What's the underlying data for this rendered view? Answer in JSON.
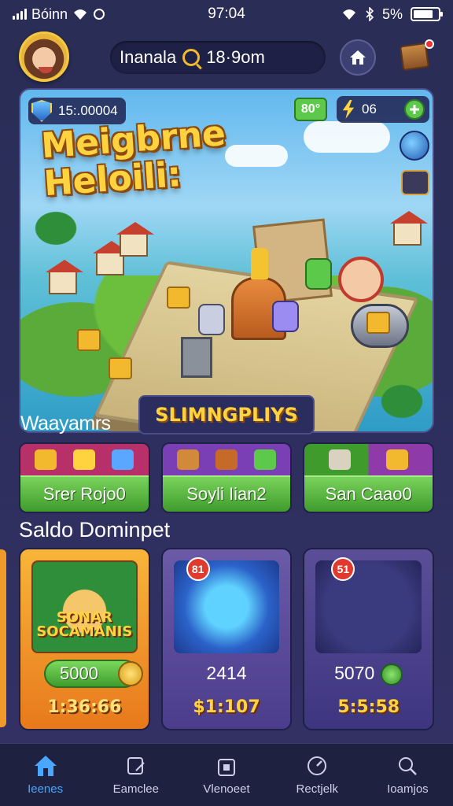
{
  "status_bar": {
    "carrier": "Bóinn",
    "time": "97:04",
    "battery_pct": "5%",
    "battery_level": 0.8
  },
  "header": {
    "search_text": "Inanala",
    "search_time": "18·9om"
  },
  "hero": {
    "title": "Meigbrne Heloili:",
    "coins": "15:.00004",
    "gems": "80°",
    "energy": "06"
  },
  "section1": {
    "title": "Waayamrs",
    "promo": "SLIMNGPLIYS",
    "categories": [
      {
        "label": "Srer Rojo0",
        "top_color": "#b8306a"
      },
      {
        "label": "Soyli Iian2",
        "top_color": "#7a3fb4"
      },
      {
        "label": "San Caao0",
        "top_color": "#8e3aa8"
      }
    ]
  },
  "section2": {
    "title": "Saldo Dominpet",
    "offers": [
      {
        "art_label": "SONAR SOCAMANIS",
        "pill_price": "5000",
        "bottom_price": "1:36:66"
      },
      {
        "badge": "81",
        "price": "2414",
        "bottom_price": "$1:107"
      },
      {
        "badge": "51",
        "price": "5070",
        "bottom_price": "5:5:58"
      }
    ]
  },
  "bottom_nav": {
    "items": [
      {
        "label": "Ieenes",
        "icon": "home-icon",
        "active": true
      },
      {
        "label": "Eamclee",
        "icon": "edit-icon",
        "active": false
      },
      {
        "label": "Vlenoeet",
        "icon": "bag-icon",
        "active": false
      },
      {
        "label": "Rectjelk",
        "icon": "gauge-icon",
        "active": false
      },
      {
        "label": "Ioamjos",
        "icon": "search-icon",
        "active": false
      }
    ]
  },
  "colors": {
    "accent_blue": "#49a7ff",
    "gold": "#ffd23f",
    "green": "#5cc94a",
    "background": "#2a2d55"
  }
}
